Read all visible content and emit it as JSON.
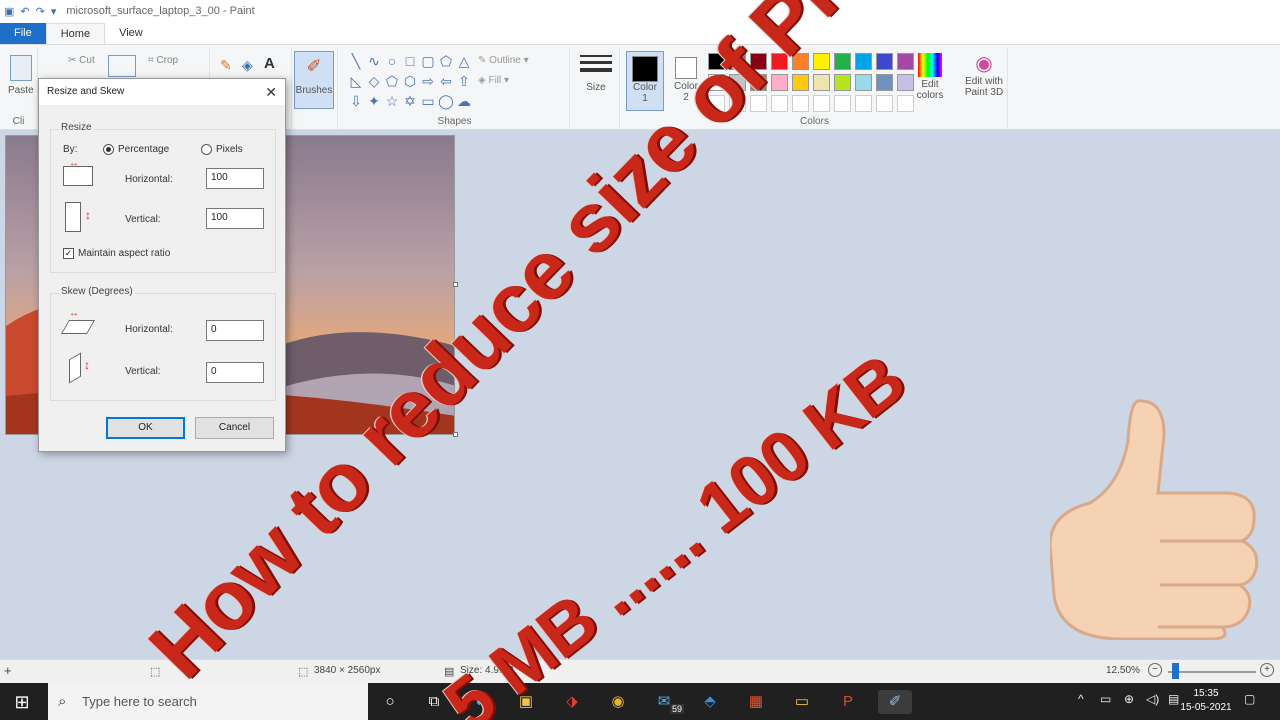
{
  "window": {
    "title": "microsoft_surface_laptop_3_00 - Paint"
  },
  "tabs": [
    {
      "label": "File"
    },
    {
      "label": "Home"
    },
    {
      "label": "View"
    }
  ],
  "ribbon": {
    "paste_label": "Paste",
    "clipboard_label": "Cli",
    "cut_label": "Cut",
    "crop_label": "Crop",
    "brushes_label": "Brushes",
    "shapes_label": "Shapes",
    "outline_label": "Outline",
    "fill_label": "Fill",
    "size_label": "Size",
    "color1_label": "Color\n1",
    "color2_label": "Color\n2",
    "edit_colors_label": "Edit\ncolors",
    "paint3d_label": "Edit with\nPaint 3D",
    "colors_group_label": "Colors",
    "palette_row1": [
      "#000000",
      "#7f7f7f",
      "#880015",
      "#ed1c24",
      "#ff7f27",
      "#fff200",
      "#22b14c",
      "#00a2e8",
      "#3f48cc",
      "#a349a4"
    ],
    "palette_row2": [
      "#ffffff",
      "#c3c3c3",
      "#b97a57",
      "#ffaec9",
      "#ffc90e",
      "#efe4b0",
      "#b5e61d",
      "#99d9ea",
      "#7092be",
      "#c8bfe7"
    ]
  },
  "dialog": {
    "title": "Resize and Skew",
    "resize_group": "Resize",
    "by_label": "By:",
    "percentage_label": "Percentage",
    "pixels_label": "Pixels",
    "horizontal_label": "Horizontal:",
    "vertical_label": "Vertical:",
    "resize_horizontal_value": "100",
    "resize_vertical_value": "100",
    "maintain_label": "Maintain aspect ratio",
    "skew_group": "Skew (Degrees)",
    "skew_horizontal_value": "0",
    "skew_vertical_value": "0",
    "ok_label": "OK",
    "cancel_label": "Cancel"
  },
  "statusbar": {
    "dimensions": "3840 × 2560px",
    "size": "Size: 4.9MB",
    "zoom": "12.50%"
  },
  "taskbar": {
    "search_placeholder": "Type here to search",
    "time": "15:35",
    "date": "15-05-2021",
    "edge_badge": "59"
  },
  "overlay": {
    "line1": "How to reduce size of PHOTO",
    "line2": "5 MB  ......  100 KB"
  }
}
